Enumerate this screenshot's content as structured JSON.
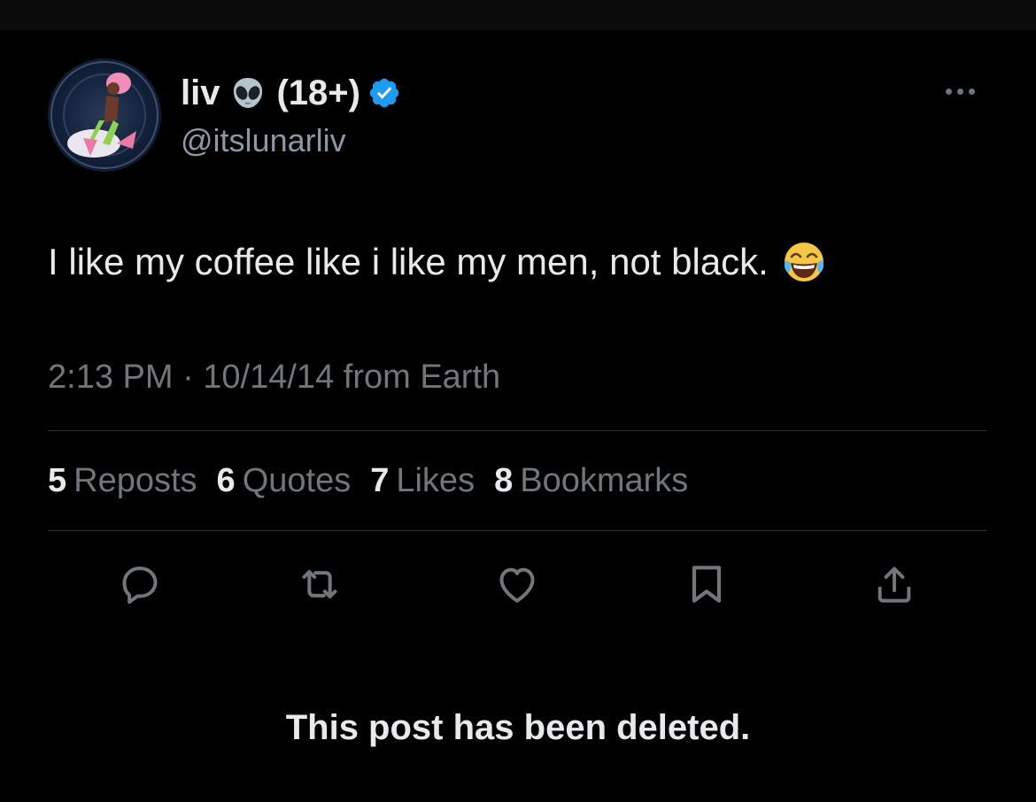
{
  "post": {
    "author": {
      "display_name": "liv",
      "name_suffix": "(18+)",
      "handle": "@itslunarliv",
      "verified": true
    },
    "text": "I like my coffee like i like my men, not black.",
    "timestamp": "2:13 PM · 10/14/14 from Earth",
    "stats": [
      {
        "value": "5",
        "label": "Reposts"
      },
      {
        "value": "6",
        "label": "Quotes"
      },
      {
        "value": "7",
        "label": "Likes"
      },
      {
        "value": "8",
        "label": "Bookmarks"
      }
    ],
    "actions": [
      "reply-icon",
      "repost-icon",
      "like-icon",
      "bookmark-icon",
      "share-icon"
    ],
    "notice": "This post has been deleted."
  },
  "colors": {
    "background": "#000000",
    "text_primary": "#e7e9ea",
    "text_secondary": "#71767b",
    "verified_blue": "#1d9bf0",
    "divider": "#2f3336"
  }
}
